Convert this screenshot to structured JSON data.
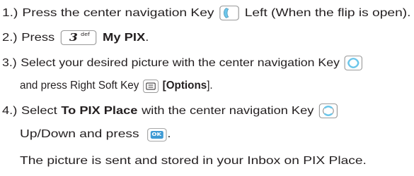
{
  "steps": [
    {
      "number": "1.)",
      "text_before": "Press the center navigation Key",
      "key_icon": "nav-left-key-icon",
      "text_after": "Left (When the flip is open)."
    },
    {
      "number": "2.)",
      "text_before": "Press",
      "key_icon": "number-3-key-icon",
      "key_digit": "3",
      "key_letters": "def",
      "bold_text": "My PIX",
      "text_after": "."
    },
    {
      "number": "3.)",
      "line1_text": "Select your desired picture with the center navigation Key",
      "line1_icon": "nav-four-way-key-icon",
      "line2_text": "and press Right Soft  Key",
      "line2_icon": "right-soft-key-icon",
      "line2_bold": "[Options",
      "line2_end": "]."
    },
    {
      "number": "4.)",
      "text_before": "Select",
      "bold_text": "To PIX Place",
      "line1_text_after": "with the center navigation Key",
      "line1_icon": "nav-up-down-key-icon",
      "line2_text": "Up/Down and press",
      "line2_icon": "ok-key-icon",
      "ok_label": "OK",
      "line2_end": "."
    }
  ],
  "note": "The picture is sent and stored in your Inbox on PIX Place.",
  "colors": {
    "text": "#231f20",
    "key_border": "#9a9a9a",
    "nav_highlight": "#6cc6ea",
    "ok_blue": "#3e9ad4"
  }
}
